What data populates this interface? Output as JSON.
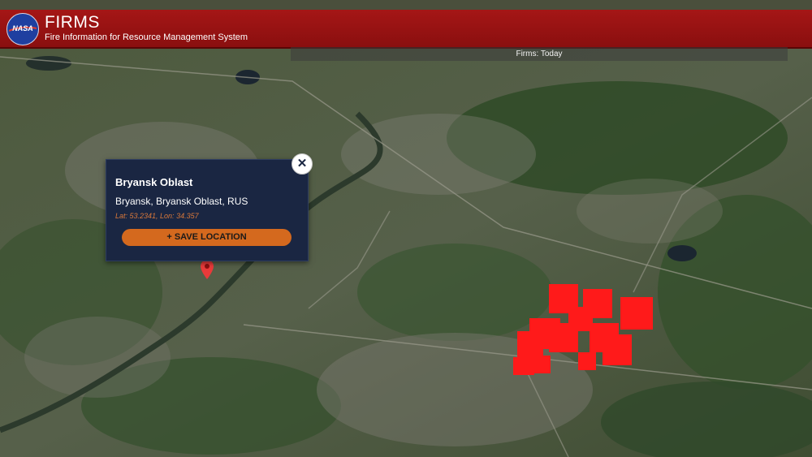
{
  "header": {
    "logo_text": "NASA",
    "title": "FIRMS",
    "subtitle": "Fire Information for Resource Management System",
    "color": "#a51616"
  },
  "map": {
    "fires_label": "Firms: Today",
    "fire_color": "#ff1a1a",
    "popup": {
      "title": "Bryansk Oblast",
      "place": "Bryansk, Bryansk Oblast, RUS",
      "coords": "Lat: 53.2341, Lon: 34.357",
      "save_label": "SAVE LOCATION",
      "close_glyph": "✕"
    },
    "icons": [
      "nasa-logo-icon",
      "map-pin-icon",
      "close-icon",
      "plus-icon"
    ]
  }
}
